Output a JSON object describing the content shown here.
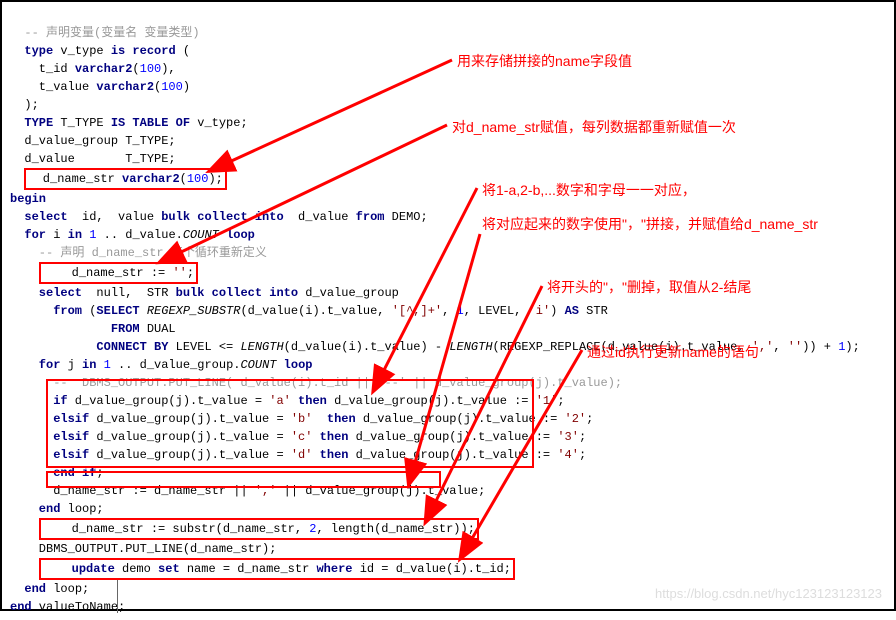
{
  "code": {
    "l01": "  -- 声明变量(变量名 变量类型)",
    "l02a": "  type",
    "l02b": " v_type ",
    "l02c": "is record",
    "l02d": " (",
    "l03": "    t_id ",
    "l03b": "varchar2",
    "l03c": "(",
    "l03d": "100",
    "l03e": "),",
    "l04": "    t_value ",
    "l04b": "varchar2",
    "l04c": "(",
    "l04d": "100",
    "l04e": ")",
    "l05": "  );",
    "l06a": "  TYPE",
    "l06b": " T_TYPE ",
    "l06c": "IS TABLE OF",
    "l06d": " v_type;",
    "l07": "  d_value_group T_TYPE;",
    "l08": "  d_value       T_TYPE;",
    "l09a": "  d_name_str ",
    "l09b": "varchar2",
    "l09c": "(",
    "l09d": "100",
    "l09e": ");",
    "l10": "begin",
    "l11a": "  select",
    "l11b": "  id,  value ",
    "l11c": "bulk collect into",
    "l11d": "  d_value ",
    "l11e": "from",
    "l11f": " DEMO;",
    "l12a": "  for",
    "l12b": " i ",
    "l12c": "in",
    "l12d": " ",
    "l12e": "1",
    "l12f": " .. d_value.",
    "l12g": "COUNT",
    "l12h": " loop",
    "l13": "    -- 声明 d_name_str 每个循环重新定义",
    "l14a": "    d_name_str := ",
    "l14b": "''",
    "l14c": ";",
    "l15a": "    select",
    "l15b": "  null,  STR ",
    "l15c": "bulk collect into",
    "l15d": " d_value_group",
    "l16a": "      from",
    "l16b": " (",
    "l16c": "SELECT",
    "l16d": " REGEXP_SUBSTR",
    "l16e": "(d_value(i).t_value, ",
    "l16f": "'[^,]+'",
    "l16g": ", ",
    "l16h": "1",
    "l16i": ", LEVEL, ",
    "l16j": "'i'",
    "l16k": ") ",
    "l16l": "AS",
    "l16m": " STR",
    "l17a": "              FROM",
    "l17b": " DUAL",
    "l18a": "            CONNECT BY",
    "l18b": " LEVEL <= ",
    "l18c": "LENGTH",
    "l18d": "(d_value(i).t_value) - ",
    "l18e": "LENGTH",
    "l18f": "(REGEXP_REPLACE(d_value(i).t_value, ",
    "l18g": "','",
    "l18h": ", ",
    "l18i": "''",
    "l18j": ")) + ",
    "l18k": "1",
    "l18l": ");",
    "l19a": "    for",
    "l19b": " j ",
    "l19c": "in",
    "l19d": " ",
    "l19e": "1",
    "l19f": " .. d_value_group.",
    "l19g": "COUNT",
    "l19h": " loop",
    "l20": "      --  DBMS_OUTPUT.PUT_LINE( d_value(i).t_id ||'---' || d_value_group(j).t_value);",
    "l21a": "      if",
    "l21b": " d_value_group(j).t_value = ",
    "l21c": "'a'",
    "l21d": " then",
    "l21e": " d_value_group(j).t_value := ",
    "l21f": "'1'",
    "l21g": ";",
    "l22a": "      elsif",
    "l22b": " d_value_group(j).t_value = ",
    "l22c": "'b'",
    "l22d": "  then",
    "l22e": " d_value_group(j).t_value := ",
    "l22f": "'2'",
    "l22g": ";",
    "l23a": "      elsif",
    "l23b": " d_value_group(j).t_value = ",
    "l23c": "'c'",
    "l23d": " then",
    "l23e": " d_value_group(j).t_value := ",
    "l23f": "'3'",
    "l23g": ";",
    "l24a": "      elsif",
    "l24b": " d_value_group(j).t_value = ",
    "l24c": "'d'",
    "l24d": " then",
    "l24e": " d_value_group(j).t_value := ",
    "l24f": "'4'",
    "l24g": ";",
    "l25": "      end if",
    "l26a": "      d_name_str := d_name_str || ",
    "l26b": "','",
    "l26c": " || d_value_group(j).t_value;",
    "l27a": "    end",
    "l27b": " loop;",
    "l28a": "    d_name_str := substr",
    "l28b": "(d_name_str, ",
    "l28c": "2",
    "l28d": ", length",
    "l28e": "(d_name_str));",
    "l29": "    DBMS_OUTPUT.PUT_LINE(d_name_str);",
    "l30a": "    update",
    "l30b": " demo ",
    "l30c": "set",
    "l30d": " name = d_name_str ",
    "l30e": "where",
    "l30f": " id = d_value(i).t_id;",
    "l31a": "  end",
    "l31b": " loop;",
    "l32a": "end",
    "l32b": " valueToName;"
  },
  "annotations": {
    "a1": "用来存储拼接的name字段值",
    "a2": "对d_name_str赋值，每列数据都重新赋值一次",
    "a3": "将1-a,2-b,...数字和字母一一对应，",
    "a4": "将对应起来的数字使用\"，\"拼接，并赋值给d_name_str",
    "a5": "将开头的\"，\"删掉，取值从2-结尾",
    "a6": "通过id执行更新name的语句"
  },
  "watermark": "https://blog.csdn.net/hyc123123123123"
}
